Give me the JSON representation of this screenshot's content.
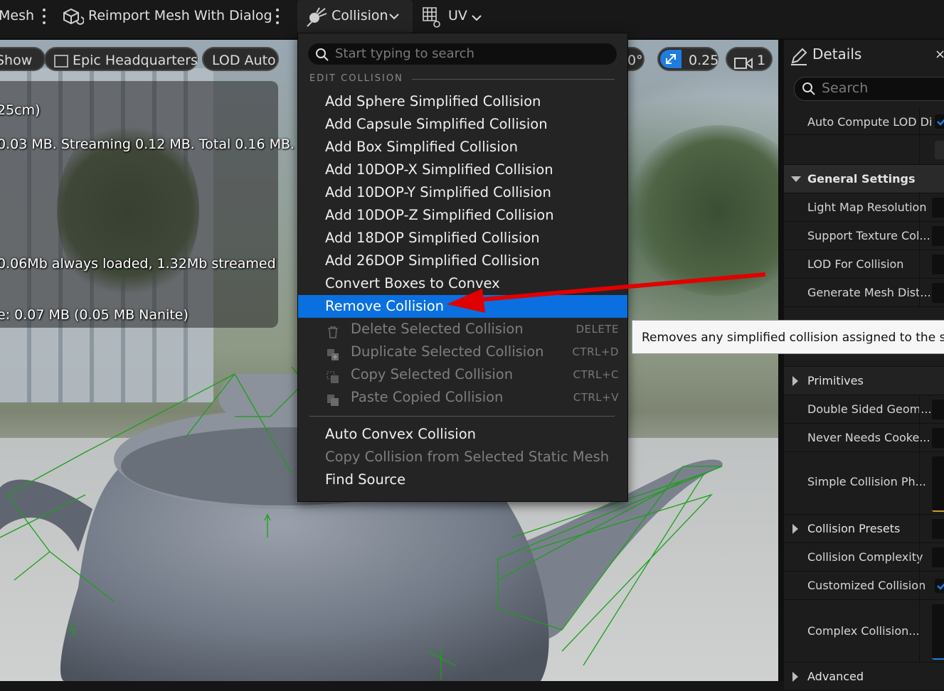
{
  "toolbar": {
    "mesh_label": "Mesh",
    "reimport_label": "Reimport Mesh With Dialog",
    "collision_label": "Collision",
    "uv_label": "UV"
  },
  "viewport": {
    "show_label": "Show",
    "environment_label": "Epic Headquarters",
    "lod_label": "LOD Auto",
    "angle_value": "0°",
    "scale_value": "0.25",
    "camera_speed": "1",
    "stats": [
      "25cm)",
      "0.03 MB. Streaming 0.12 MB. Total 0.16 MB.",
      "0.06Mb always loaded, 1.32Mb streamed",
      "e: 0.07 MB (0.05 MB Nanite)"
    ]
  },
  "menu": {
    "search_placeholder": "Start typing to search",
    "section_header": "EDIT COLLISION",
    "items": [
      {
        "label": "Add Sphere Simplified Collision"
      },
      {
        "label": "Add Capsule Simplified Collision"
      },
      {
        "label": "Add Box Simplified Collision"
      },
      {
        "label": "Add 10DOP-X Simplified Collision"
      },
      {
        "label": "Add 10DOP-Y Simplified Collision"
      },
      {
        "label": "Add 10DOP-Z Simplified Collision"
      },
      {
        "label": "Add 18DOP Simplified Collision"
      },
      {
        "label": "Add 26DOP Simplified Collision"
      },
      {
        "label": "Convert Boxes to Convex"
      },
      {
        "label": "Remove Collision"
      }
    ],
    "disabled_items": [
      {
        "label": "Delete Selected Collision",
        "shortcut": "DELETE",
        "icon": "trash-icon"
      },
      {
        "label": "Duplicate Selected Collision",
        "shortcut": "CTRL+D",
        "icon": "duplicate-icon"
      },
      {
        "label": "Copy Selected Collision",
        "shortcut": "CTRL+C",
        "icon": "copy-icon"
      },
      {
        "label": "Paste Copied Collision",
        "shortcut": "CTRL+V",
        "icon": "paste-icon"
      }
    ],
    "bottom_items": [
      {
        "label": "Auto Convex Collision"
      },
      {
        "label": "Copy Collision from Selected Static Mesh"
      },
      {
        "label": "Find Source"
      }
    ],
    "highlight_color": "#0a70e0"
  },
  "tooltip": {
    "text": "Removes any simplified collision assigned to the stati"
  },
  "details": {
    "title": "Details",
    "close": "×",
    "search_placeholder": "Search",
    "rows": [
      {
        "label": "Auto Compute LOD Di",
        "type": "checkbox"
      },
      {
        "label": "",
        "type": "blank"
      },
      {
        "label": "General Settings",
        "type": "group"
      },
      {
        "label": "Light Map Resolution",
        "type": "value"
      },
      {
        "label": "Support Texture Col...",
        "type": "value"
      },
      {
        "label": "LOD For Collision",
        "type": "value"
      },
      {
        "label": "Generate Mesh Dist...",
        "type": "value"
      },
      {
        "label": "Primitives",
        "type": "subgroup"
      },
      {
        "label": "Double Sided Geom...",
        "type": "value"
      },
      {
        "label": "Never Needs Cooke...",
        "type": "value"
      },
      {
        "label": "Simple Collision Ph...",
        "type": "value"
      },
      {
        "label": "Collision Presets",
        "type": "subgroup"
      },
      {
        "label": "Collision Complexity",
        "type": "value"
      },
      {
        "label": "Customized Collision",
        "type": "checkbox"
      },
      {
        "label": "Complex Collision...",
        "type": "value"
      },
      {
        "label": "Advanced",
        "type": "subgroup"
      }
    ],
    "accent_color": "#1f7de0"
  },
  "annotation": {
    "arrow_color": "#e00000"
  }
}
